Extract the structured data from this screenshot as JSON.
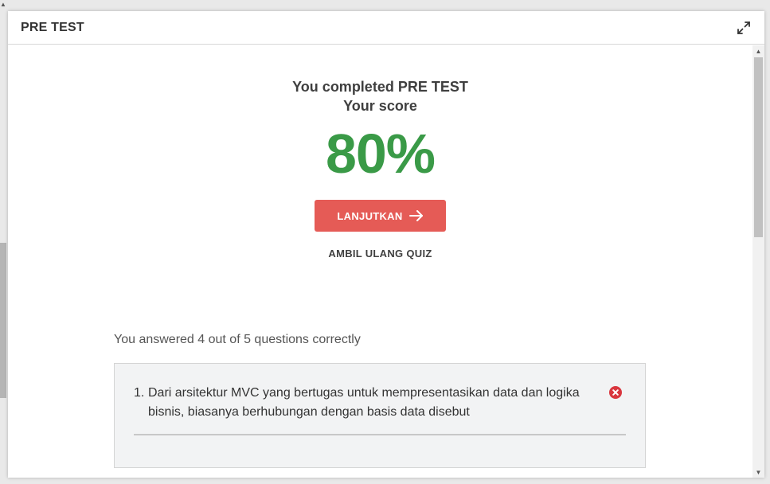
{
  "modal": {
    "title": "PRE TEST",
    "expand_icon": "expand-icon"
  },
  "result": {
    "completed_text": "You completed PRE TEST",
    "score_label": "Your score",
    "score_value": "80%",
    "continue_label": "LANJUTKAN",
    "continue_icon": "arrow-right-icon",
    "retake_label": "AMBIL ULANG QUIZ"
  },
  "summary": {
    "text": "You answered 4 out of 5 questions correctly"
  },
  "questions": [
    {
      "number": "1.",
      "text": "Dari arsitektur MVC yang bertugas untuk mempresentasikan data dan logika bisnis, biasanya berhubungan dengan basis data disebut",
      "status_icon": "wrong-icon",
      "status": "incorrect"
    }
  ],
  "colors": {
    "score": "#3a9a47",
    "continue_button": "#e55b56",
    "wrong_icon": "#d9363e"
  }
}
